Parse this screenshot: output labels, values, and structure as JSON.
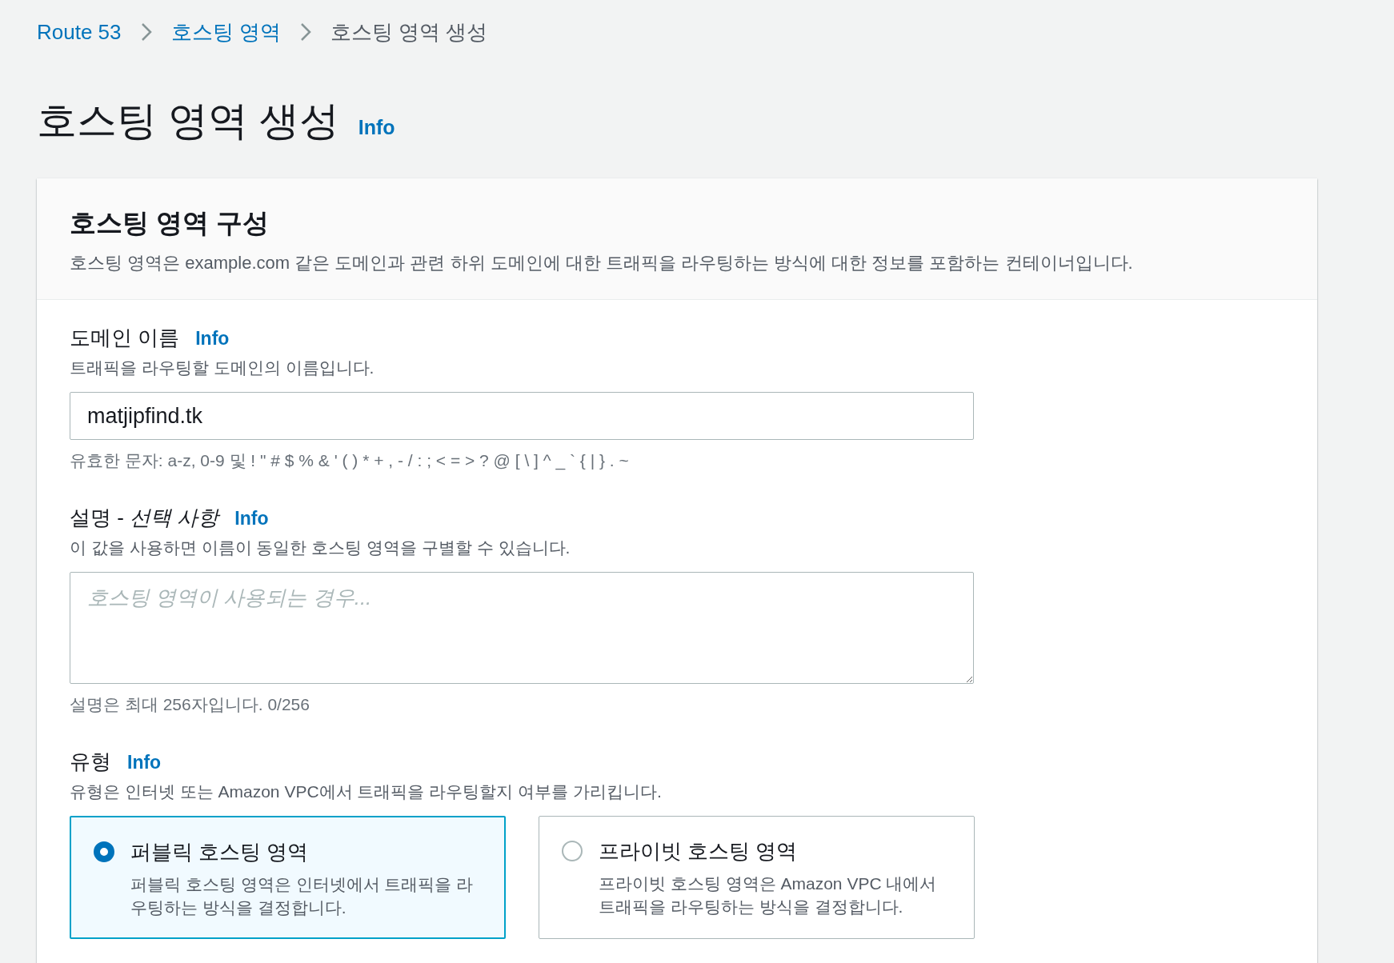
{
  "breadcrumbs": [
    {
      "label": "Route 53",
      "link": true
    },
    {
      "label": "호스팅 영역",
      "link": true
    },
    {
      "label": "호스팅 영역 생성",
      "link": false
    }
  ],
  "page_title": "호스팅 영역 생성",
  "page_info": "Info",
  "panel": {
    "title": "호스팅 영역 구성",
    "description": "호스팅 영역은 example.com 같은 도메인과 관련 하위 도메인에 대한 트래픽을 라우팅하는 방식에 대한 정보를 포함하는 컨테이너입니다.",
    "fields": [
      {
        "kind": "input",
        "label": "도메인 이름",
        "info": "Info",
        "description": "트래픽을 라우팅할 도메인의 이름입니다.",
        "value": "matjipfind.tk",
        "constraint": "유효한 문자: a-z, 0-9 및 ! \" # $ % & ' ( ) * + , - / : ; < = > ? @ [ \\ ] ^ _ ` { | } . ~"
      },
      {
        "kind": "textarea",
        "label": "설명 - *선택 사항*",
        "info": "Info",
        "description": "이 값을 사용하면 이름이 동일한 호스팅 영역을 구별할 수 있습니다.",
        "placeholder": "호스팅 영역이 사용되는 경우...",
        "constraint": "설명은 최대 256자입니다. 0/256"
      },
      {
        "kind": "tiles",
        "label": "유형",
        "info": "Info",
        "description": "유형은 인터넷 또는 Amazon VPC에서 트래픽을 라우팅할지 여부를 가리킵니다.",
        "options": [
          {
            "title": "퍼블릭 호스팅 영역",
            "description": "퍼블릭 호스팅 영역은 인터넷에서 트래픽을 라우팅하는 방식을 결정합니다.",
            "selected": true
          },
          {
            "title": "프라이빗 호스팅 영역",
            "description": "프라이빗 호스팅 영역은 Amazon VPC 내에서 트래픽을 라우팅하는 방식을 결정합니다.",
            "selected": false
          }
        ]
      }
    ]
  }
}
